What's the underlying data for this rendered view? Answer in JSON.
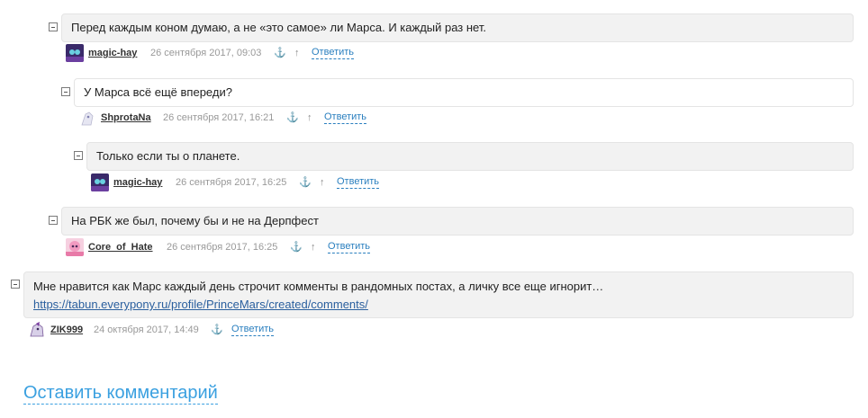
{
  "colors": {
    "link": "#2a7fbf",
    "leave_link": "#3aa0e0",
    "bubble_gray": "#f2f2f2"
  },
  "comments": [
    {
      "text": "Перед каждым коном думаю, а не «это самое» ли Марса. И каждый раз нет.",
      "author": "magic-hay",
      "date": "26 сентября 2017, 09:03",
      "anchor_icon": "⚓",
      "parent_icon": "↑",
      "reply_label": "Ответить"
    },
    {
      "text": "У Марса всё ещё впереди?",
      "author": "ShprotaNa",
      "date": "26 сентября 2017, 16:21",
      "anchor_icon": "⚓",
      "parent_icon": "↑",
      "reply_label": "Ответить"
    },
    {
      "text": "Только если ты о планете.",
      "author": "magic-hay",
      "date": "26 сентября 2017, 16:25",
      "anchor_icon": "⚓",
      "parent_icon": "↑",
      "reply_label": "Ответить"
    },
    {
      "text": "На РБК же был, почему бы и не на Дерпфест",
      "author": "Core_of_Hate",
      "date": "26 сентября 2017, 16:25",
      "anchor_icon": "⚓",
      "parent_icon": "↑",
      "reply_label": "Ответить"
    },
    {
      "text": "Мне нравится как Марс каждый день строчит комменты в рандомных постах, а личку все еще игнорит…",
      "link": "https://tabun.everypony.ru/profile/PrinceMars/created/comments/",
      "author": "ZIK999",
      "date": "24 октября 2017, 14:49",
      "anchor_icon": "⚓",
      "reply_label": "Ответить"
    }
  ],
  "leave_comment_label": "Оставить комментарий"
}
